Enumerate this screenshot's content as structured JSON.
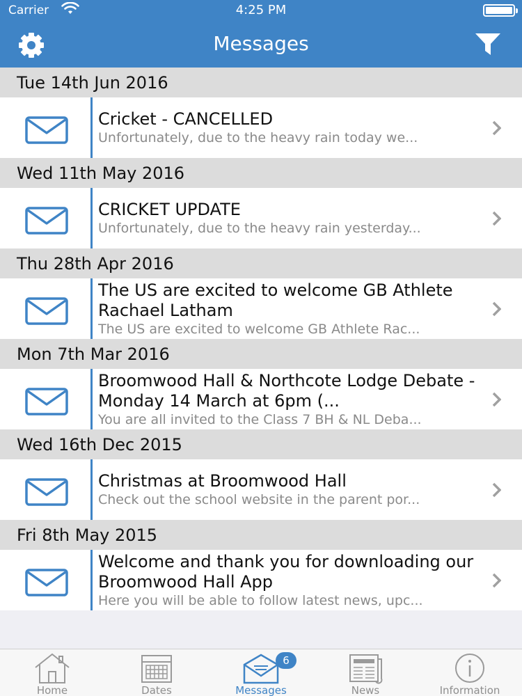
{
  "status_bar": {
    "carrier": "Carrier",
    "time": "4:25 PM"
  },
  "header": {
    "title": "Messages",
    "left_icon": "gear-icon",
    "right_icon": "filter-icon"
  },
  "colors": {
    "accent": "#3f84c6",
    "section_bg": "#dcdcdc",
    "preview_text": "#8a8a8a"
  },
  "messages": [
    {
      "date": "Tue 14th Jun 2016",
      "title": "Cricket - CANCELLED",
      "preview": "Unfortunately, due to the heavy rain today we..."
    },
    {
      "date": "Wed 11th May 2016",
      "title": "CRICKET UPDATE",
      "preview": "Unfortunately, due to the heavy rain yesterday..."
    },
    {
      "date": "Thu 28th Apr 2016",
      "title": "The US are excited to welcome GB Athlete Rachael Latham",
      "preview": "The US are excited to welcome GB Athlete Rac..."
    },
    {
      "date": "Mon 7th Mar 2016",
      "title": "Broomwood Hall & Northcote Lodge Debate - Monday 14 March at 6pm (...",
      "preview": "You are all invited to the Class 7 BH & NL Deba..."
    },
    {
      "date": "Wed 16th Dec 2015",
      "title": "Christmas at Broomwood Hall",
      "preview": "Check out the school website in the parent por..."
    },
    {
      "date": "Fri 8th May 2015",
      "title": "Welcome and thank you for downloading our Broomwood Hall App",
      "preview": "Here you will be able to follow latest news, upc..."
    }
  ],
  "tabs": [
    {
      "label": "Home",
      "icon": "home-icon"
    },
    {
      "label": "Dates",
      "icon": "calendar-icon"
    },
    {
      "label": "Messages",
      "icon": "messages-icon",
      "badge": "6",
      "active": true
    },
    {
      "label": "News",
      "icon": "newspaper-icon"
    },
    {
      "label": "Information",
      "icon": "info-icon"
    }
  ]
}
